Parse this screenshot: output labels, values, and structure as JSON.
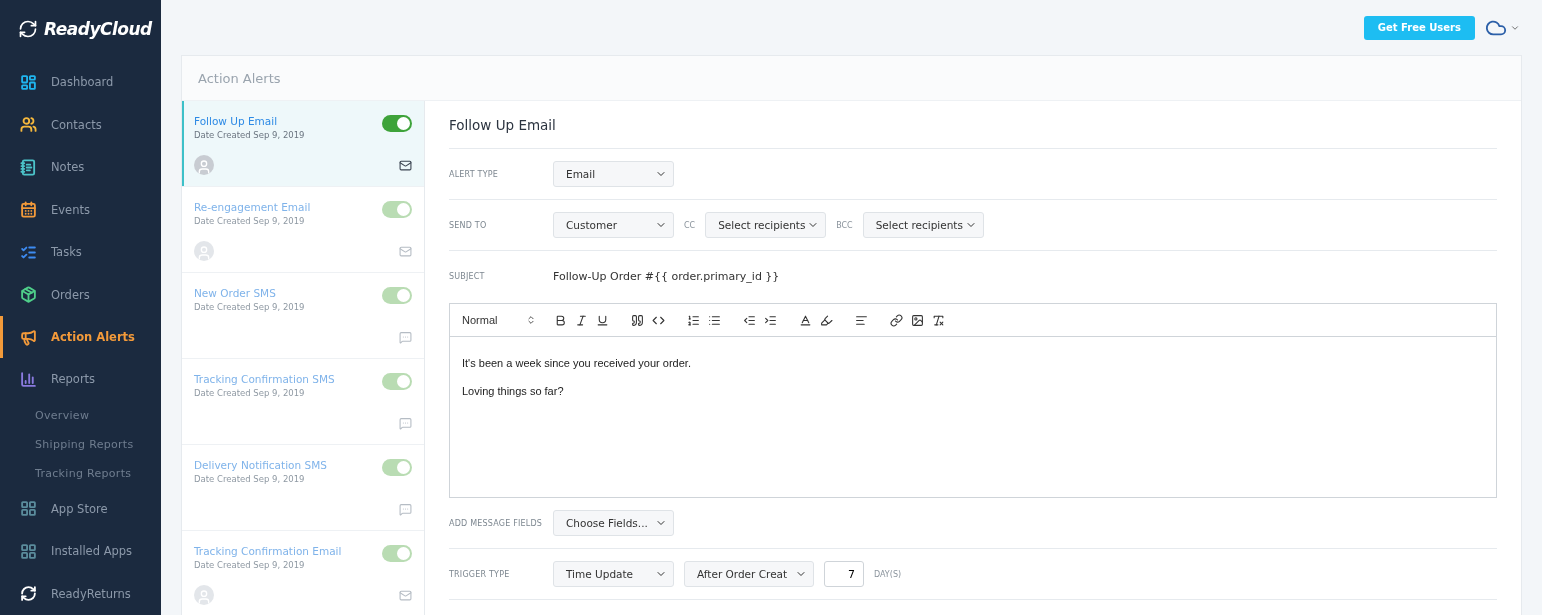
{
  "sidebar": {
    "logo": "ReadyCloud",
    "items": [
      {
        "label": "Dashboard",
        "kind": "dashboard",
        "selected": false,
        "color": "#1fb6f0"
      },
      {
        "label": "Contacts",
        "kind": "contacts",
        "selected": false,
        "color": "#f5b83d"
      },
      {
        "label": "Notes",
        "kind": "notes",
        "selected": false,
        "color": "#4cc3c9"
      },
      {
        "label": "Events",
        "kind": "events",
        "selected": false,
        "color": "#f39a3a"
      },
      {
        "label": "Tasks",
        "kind": "tasks",
        "selected": false,
        "color": "#3d8bf2"
      },
      {
        "label": "Orders",
        "kind": "orders",
        "selected": false,
        "color": "#4fcf8a"
      },
      {
        "label": "Action Alerts",
        "kind": "alerts",
        "selected": true,
        "color": "#f39a3a"
      },
      {
        "label": "Reports",
        "kind": "reports",
        "selected": false,
        "color": "#8b7be0",
        "children": [
          {
            "label": "Overview"
          },
          {
            "label": "Shipping Reports"
          },
          {
            "label": "Tracking Reports"
          }
        ]
      },
      {
        "label": "App Store",
        "kind": "apps",
        "selected": false,
        "color": "#5b8c9c"
      },
      {
        "label": "Installed Apps",
        "kind": "apps",
        "selected": false,
        "color": "#5b8c9c"
      },
      {
        "label": "ReadyReturns",
        "kind": "returns",
        "selected": false,
        "color": "#ffffff"
      }
    ]
  },
  "topbar": {
    "button": "Get Free Users"
  },
  "panel": {
    "title": "Action Alerts"
  },
  "alerts": [
    {
      "name": "Follow Up Email",
      "date": "Date Created Sep 9, 2019",
      "on": true,
      "selected": true,
      "avatar": true,
      "kind": "email"
    },
    {
      "name": "Re-engagement Email",
      "date": "Date Created Sep 9, 2019",
      "on": true,
      "selected": false,
      "avatar": true,
      "kind": "email"
    },
    {
      "name": "New Order SMS",
      "date": "Date Created Sep 9, 2019",
      "on": true,
      "selected": false,
      "avatar": false,
      "kind": "sms"
    },
    {
      "name": "Tracking Confirmation SMS",
      "date": "Date Created Sep 9, 2019",
      "on": true,
      "selected": false,
      "avatar": false,
      "kind": "sms"
    },
    {
      "name": "Delivery Notification SMS",
      "date": "Date Created Sep 9, 2019",
      "on": true,
      "selected": false,
      "avatar": false,
      "kind": "sms"
    },
    {
      "name": "Tracking Confirmation Email",
      "date": "Date Created Sep 9, 2019",
      "on": true,
      "selected": false,
      "avatar": true,
      "kind": "email"
    }
  ],
  "editor": {
    "title": "Follow Up Email",
    "alert_type": {
      "label": "ALERT TYPE",
      "value": "Email"
    },
    "send_to": {
      "label": "SEND TO",
      "value": "Customer",
      "cc_label": "CC",
      "cc_value": "Select recipients",
      "bcc_label": "BCC",
      "bcc_value": "Select recipients"
    },
    "subject": {
      "label": "SUBJECT",
      "value": "Follow-Up Order #{{ order.primary_id }}"
    },
    "toolbar": {
      "format": "Normal"
    },
    "body": [
      "It's been a week since you received your order.",
      "Loving things so far?"
    ],
    "message_fields": {
      "label": "ADD MESSAGE FIELDS",
      "value": "Choose Fields..."
    },
    "trigger": {
      "label": "TRIGGER TYPE",
      "type": "Time Update",
      "event": "After Order Creat",
      "amount": "7",
      "unit": "DAY(S)"
    }
  }
}
